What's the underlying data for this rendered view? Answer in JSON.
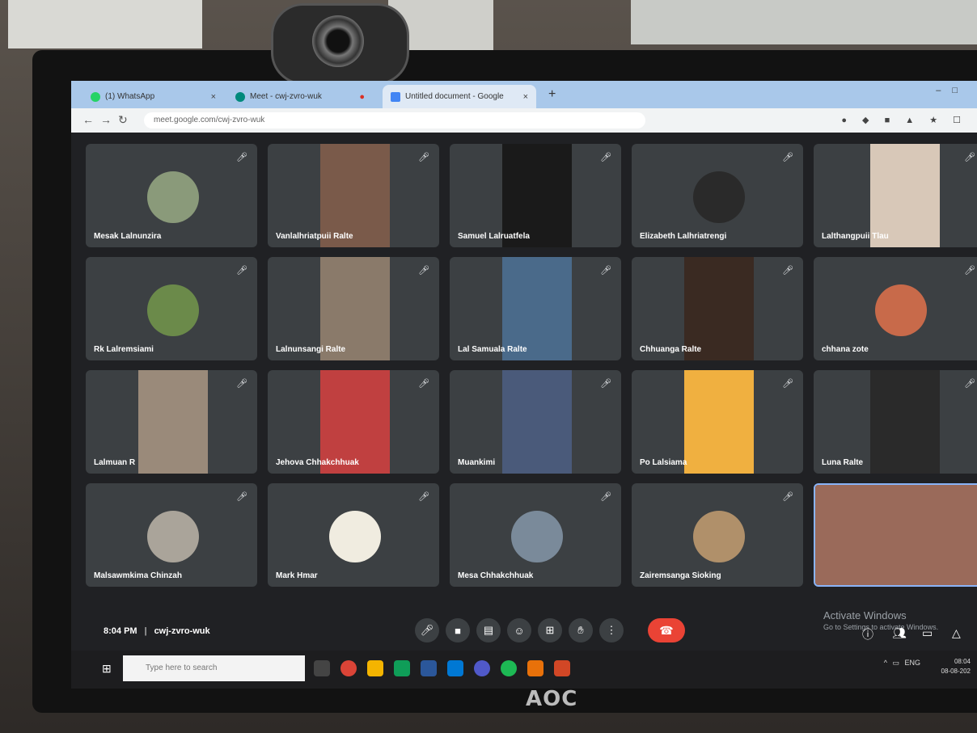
{
  "browser": {
    "tabs": [
      {
        "label": "(1) WhatsApp"
      },
      {
        "label": "Meet - cwj-zvro-wuk"
      },
      {
        "label": "Untitled document - Google"
      }
    ],
    "url": "meet.google.com/cwj-zvro-wuk"
  },
  "participants": [
    {
      "name": "Mesak Lalnunzira"
    },
    {
      "name": "Vanlalhriatpuii Ralte"
    },
    {
      "name": "Samuel Lalruatfela"
    },
    {
      "name": "Elizabeth Lalhriatrengi"
    },
    {
      "name": "Lalthangpuii Tlau"
    },
    {
      "name": "Rk Lalremsiami"
    },
    {
      "name": "Lalnunsangi Ralte"
    },
    {
      "name": "Lal Samuala Ralte"
    },
    {
      "name": "Chhuanga Ralte"
    },
    {
      "name": "chhana zote"
    },
    {
      "name": "Lalmuan R"
    },
    {
      "name": "Jehova Chhakchhuak"
    },
    {
      "name": "Muankimi"
    },
    {
      "name": "Po Lalsiama"
    },
    {
      "name": "Luna Ralte"
    },
    {
      "name": "Malsawmkima Chinzah"
    },
    {
      "name": "Mark Hmar"
    },
    {
      "name": "Mesa Chhakchhuak"
    },
    {
      "name": "Zairemsanga Sioking"
    },
    {
      "name": ""
    }
  ],
  "meeting": {
    "time": "8:04 PM",
    "separator": "|",
    "code": "cwj-zvro-wuk"
  },
  "watermark": {
    "line1": "Activate Windows",
    "line2": "Go to Settings to activate Windows."
  },
  "taskbar": {
    "search_placeholder": "Type here to search",
    "lang": "ENG",
    "clock_time": "08:04",
    "clock_date": "08-08-202"
  },
  "monitor_brand": "AOC",
  "colors": {
    "end_call": "#ea4335",
    "tile": "#3c4043",
    "screen_bg": "#202124"
  }
}
